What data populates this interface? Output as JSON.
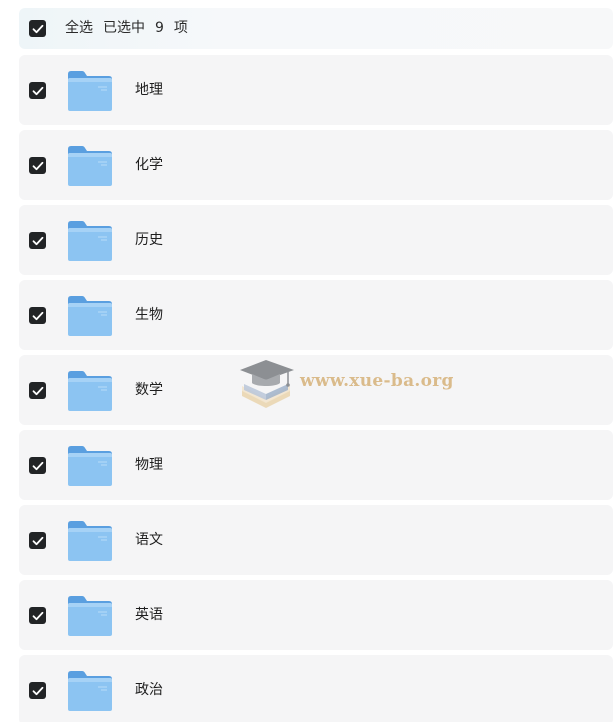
{
  "header": {
    "select_all_label": "全选",
    "selected_prefix": "已选中",
    "selected_count": "9",
    "selected_suffix": "项",
    "checked": true
  },
  "folders": [
    {
      "name": "地理",
      "checked": true
    },
    {
      "name": "化学",
      "checked": true
    },
    {
      "name": "历史",
      "checked": true
    },
    {
      "name": "生物",
      "checked": true
    },
    {
      "name": "数学",
      "checked": true
    },
    {
      "name": "物理",
      "checked": true
    },
    {
      "name": "语文",
      "checked": true
    },
    {
      "name": "英语",
      "checked": true
    },
    {
      "name": "政治",
      "checked": true
    }
  ],
  "icons": {
    "checkbox": "checkbox-checked-icon",
    "folder": "folder-icon",
    "watermark_logo": "graduation-cap-book-logo"
  },
  "watermark": {
    "text": "www.xue-ba.org"
  },
  "colors": {
    "checkbox_bg": "#222426",
    "row_bg": "#f5f5f6",
    "folder_blue": "#7ab8ec",
    "watermark_text": "#d9b886"
  }
}
